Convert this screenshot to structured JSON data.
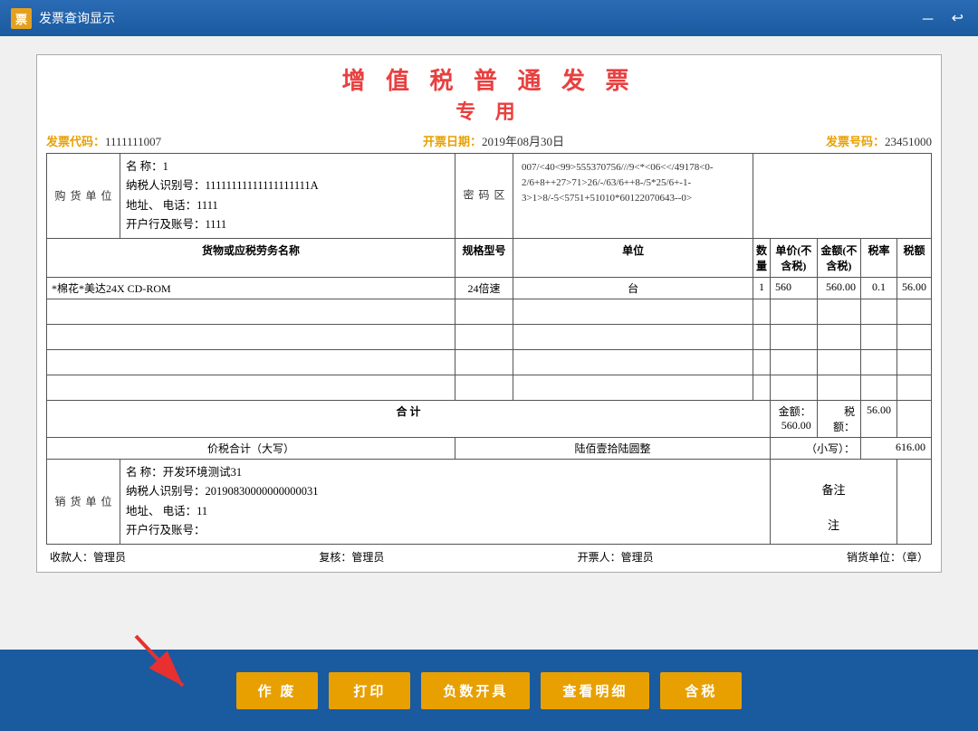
{
  "titleBar": {
    "iconText": "票",
    "title": "发票查询显示",
    "minimizeBtn": "－",
    "closeBtn": "↩"
  },
  "invoice": {
    "mainTitle": "增 值 税 普 通 发 票",
    "subTitle": "专 用",
    "metaLeft": "发票代码：",
    "metaLeftValue": "1111111007",
    "metaCenter": "开票日期：",
    "metaCenterValue": "2019年08月30日",
    "metaRight": "发票号码：",
    "metaRightValue": "23451000",
    "buyer": {
      "sideLabel": "购货单位",
      "name": "名    称：1",
      "taxId": "纳税人识别号：11111111111111111111A",
      "address": "地址、  电话：1111",
      "bank": "开户行及账号：1111"
    },
    "codeBox": {
      "label": "密码区",
      "content": "007/<40<99>555370756///9<*<06<</49178<0-2/6+8++27>71>26/-/63/6++8-/5*25/6+-1-3>1>8/-5<5751+51010*60122070643--0>"
    },
    "tableHeaders": [
      "货物或应税劳务名称",
      "规格型号",
      "单位",
      "数量",
      "单价(不含税)",
      "金额(不含税)",
      "税率",
      "税额"
    ],
    "tableRow": {
      "name": "*棉花*美达24X CD-ROM",
      "spec": "24倍速",
      "unit": "台",
      "qty": "1",
      "unitPrice": "560",
      "amount": "560.00",
      "taxRate": "0.1",
      "taxAmount": "56.00"
    },
    "totalRow": {
      "label": "合  计",
      "amountLabel": "金额：",
      "amount": "560.00",
      "taxLabel": "税额：",
      "tax": "56.00"
    },
    "subtotalRow": {
      "label": "价税合计（大写）",
      "chinese": "陆佰壹拾陆圆整",
      "smallLabel": "（小写）：",
      "small": "616.00"
    },
    "seller": {
      "sideLabel": "销货单位",
      "name": "名    称：开发环境测试31",
      "taxId": "纳税人识别号：20190830000000000031",
      "address": "地址、  电话：11",
      "bank": "开户行及账号："
    },
    "remarkLabel": "备注",
    "signRow": {
      "payee": "收款人：管理员",
      "review": "复核：管理员",
      "issuer": "开票人：管理员",
      "seller": "销货单位：（章）"
    }
  },
  "buttons": {
    "void": "作  废",
    "print": "打印",
    "negative": "负数开具",
    "detail": "查看明细",
    "tax": "含税"
  }
}
